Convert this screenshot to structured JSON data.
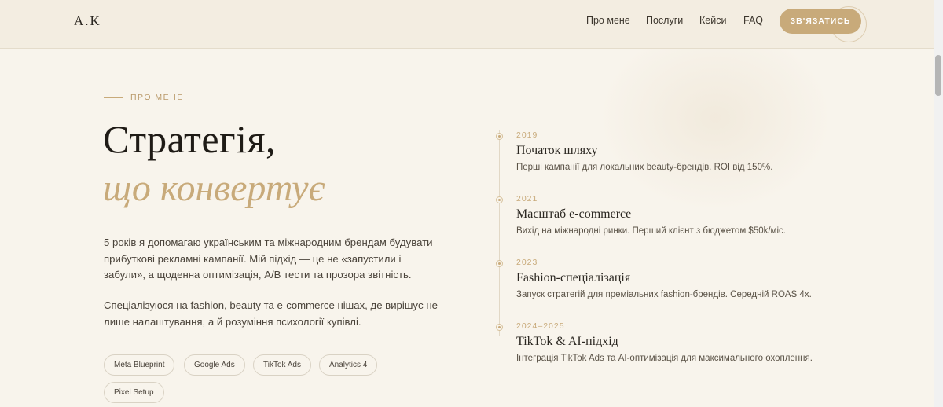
{
  "header": {
    "logo": "A.K",
    "nav": [
      "Про мене",
      "Послуги",
      "Кейси",
      "FAQ"
    ],
    "cta_label": "ЗВ'ЯЗАТИСЬ"
  },
  "about": {
    "eyebrow": "ПРО МЕНЕ",
    "title": "Стратегія,",
    "subtitle": "що конвертує",
    "paragraph1": "5 років я допомагаю українським та міжнародним брендам будувати прибуткові рекламні кампанії. Мій підхід — це не «запустили і забули», а щоденна оптимізація, A/B тести та прозора звітність.",
    "paragraph2": "Спеціалізуюся на fashion, beauty та e-commerce нішах, де вирішує не лише налаштування, а й розуміння психології купівлі.",
    "tags": [
      "Meta Blueprint",
      "Google Ads",
      "TikTok Ads",
      "Analytics 4",
      "Pixel Setup"
    ]
  },
  "timeline": [
    {
      "year": "2019",
      "title": "Початок шляху",
      "desc": "Перші кампанії для локальних beauty-брендів. ROI від 150%."
    },
    {
      "year": "2021",
      "title": "Масштаб e-commerce",
      "desc": "Вихід на міжнародні ринки. Перший клієнт з бюджетом $50k/міс."
    },
    {
      "year": "2023",
      "title": "Fashion-спеціалізація",
      "desc": "Запуск стратегій для преміальних fashion-брендів. Середній ROAS 4x."
    },
    {
      "year": "2024–2025",
      "title": "TikTok & AI-підхід",
      "desc": "Інтеграція TikTok Ads та AI-оптимізація для максимального охоплення."
    }
  ],
  "colors": {
    "accent": "#c8aa7a",
    "background": "#f8f4ec",
    "text": "#2b2721"
  }
}
